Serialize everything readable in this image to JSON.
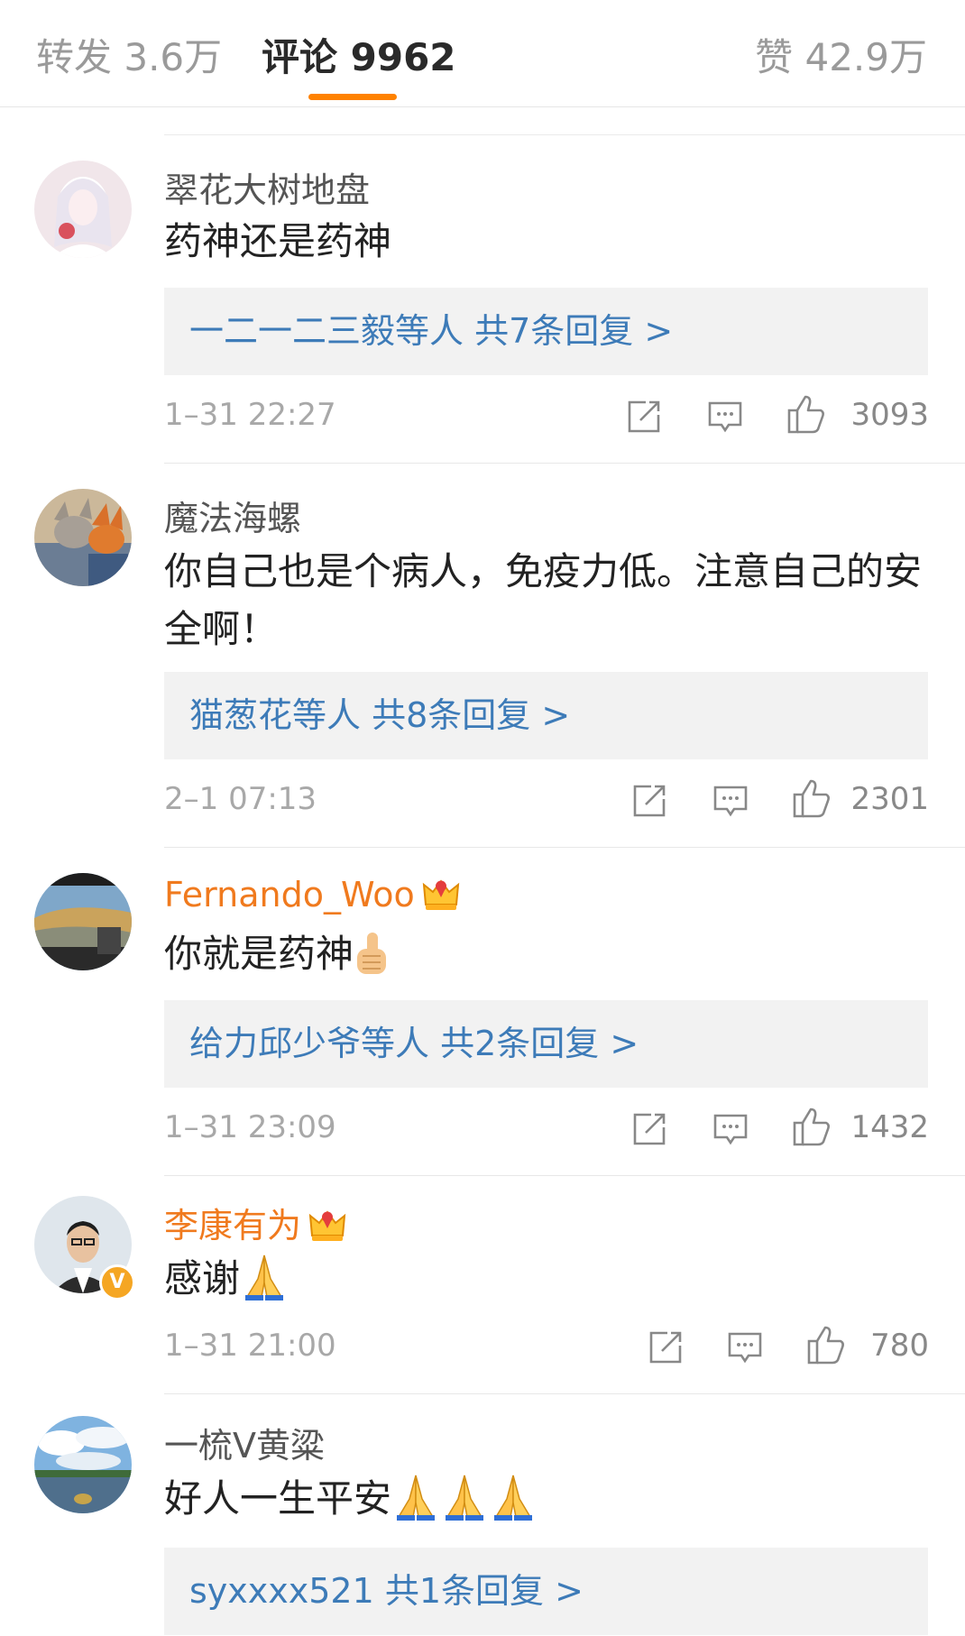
{
  "tabs": {
    "repost": "转发 3.6万",
    "comments": "评论 9962",
    "likes": "赞 42.9万"
  },
  "accent_color": "#ff8200",
  "link_color": "#3d7bb8",
  "comments": [
    {
      "username": "翠花大树地盘",
      "text": "药神还是药神",
      "reply_summary": "一二一二三毅等人  共7条回复 >",
      "time": "1–31 22:27",
      "like_count": "3093"
    },
    {
      "username": "魔法海螺",
      "text": "你自己也是个病人，免疫力低。注意自己的安全啊！",
      "reply_summary": "猫葱花等人  共8条回复 >",
      "time": "2–1 07:13",
      "like_count": "2301"
    },
    {
      "username": "Fernando_Woo",
      "badge": "crown-icon",
      "text": "你就是药神",
      "emoji": "thumbs-up-emoji",
      "reply_summary": "给力邱少爷等人  共2条回复 >",
      "time": "1–31 23:09",
      "like_count": "1432"
    },
    {
      "username": "李康有为",
      "badge": "crown-icon",
      "verified": "V",
      "text": "感谢",
      "emoji": "pray-emoji",
      "time": "1–31 21:00",
      "like_count": "780"
    },
    {
      "username": "一梳V黄粱",
      "text": "好人一生平安",
      "emoji": "pray-emoji x3",
      "reply_summary": "syxxxx521  共1条回复 >"
    }
  ],
  "icons": [
    "share-icon",
    "comment-icon",
    "like-icon"
  ]
}
